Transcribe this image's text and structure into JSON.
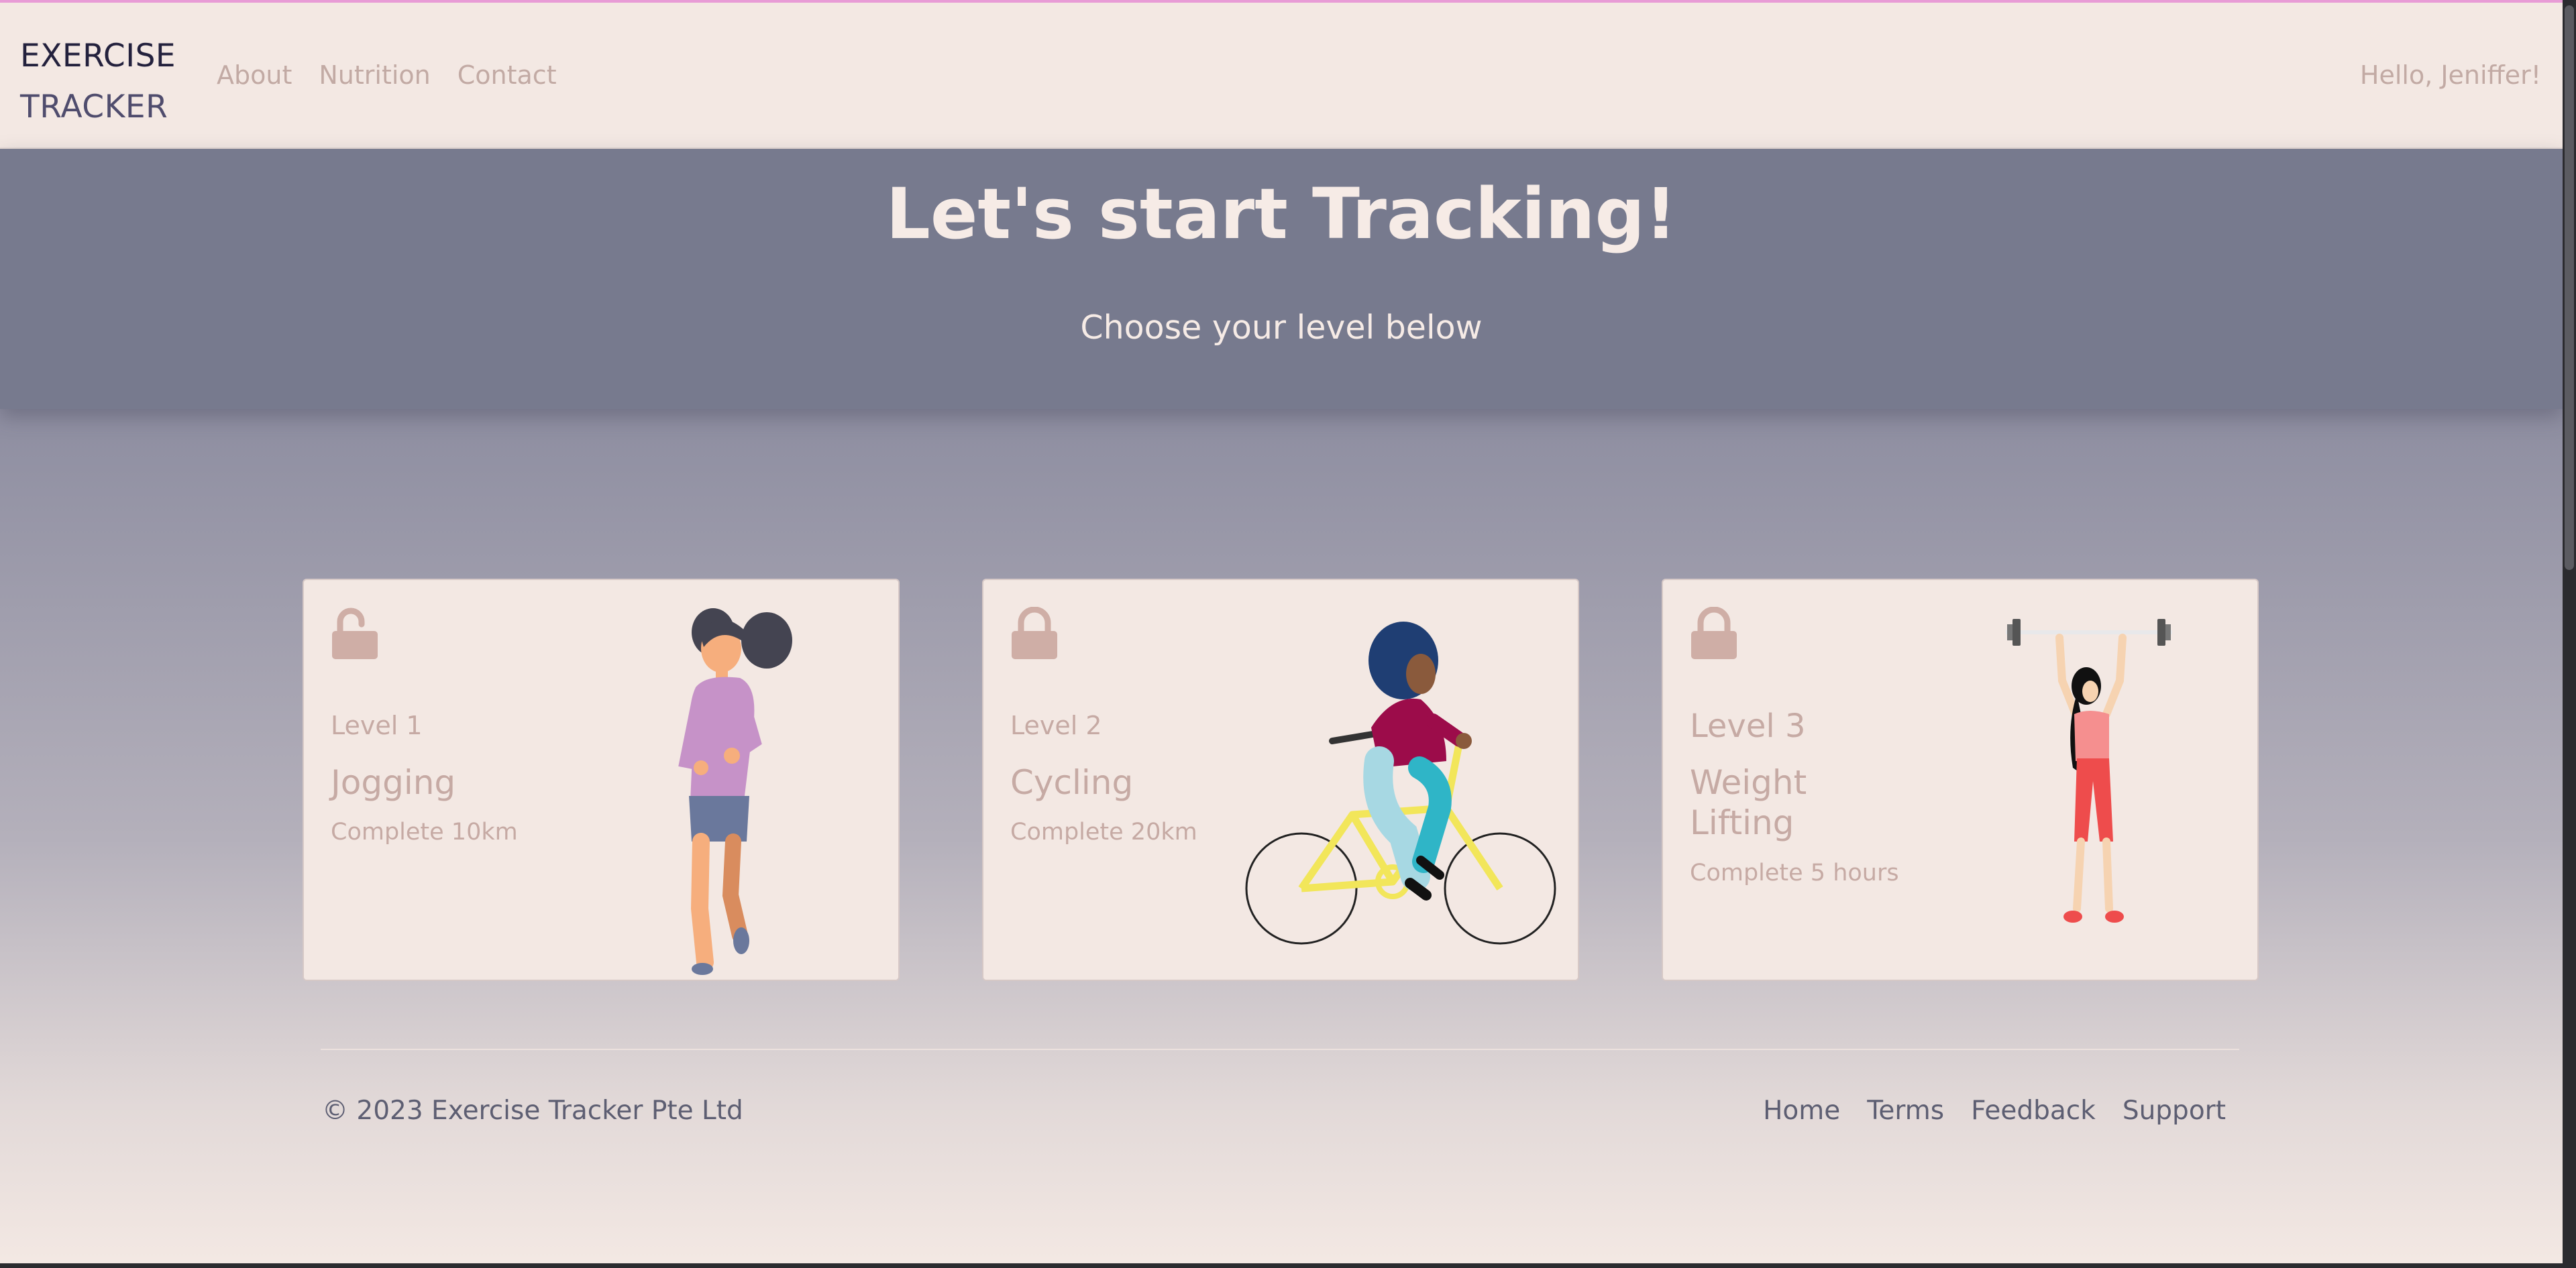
{
  "navbar": {
    "brand_line1": "EXERCISE",
    "brand_line2": "TRACKER",
    "links": [
      {
        "label": "About"
      },
      {
        "label": "Nutrition"
      },
      {
        "label": "Contact"
      }
    ],
    "greeting": "Hello, Jeniffer!"
  },
  "hero": {
    "title": "Let's start Tracking!",
    "subtitle": "Choose your level below"
  },
  "levels": [
    {
      "level": "Level 1",
      "name": "Jogging",
      "goal": "Complete 10km",
      "lock_icon": "unlocked-padlock-icon",
      "illustration": "jogging-woman"
    },
    {
      "level": "Level 2",
      "name": "Cycling",
      "goal": "Complete 20km",
      "lock_icon": "locked-padlock-icon",
      "illustration": "cycling-woman"
    },
    {
      "level": "Level 3",
      "name": "Weight Lifting",
      "goal": "Complete 5 hours",
      "lock_icon": "locked-padlock-icon",
      "illustration": "weightlifting-woman"
    }
  ],
  "footer": {
    "copyright": "© 2023 Exercise Tracker Pte Ltd",
    "links": [
      {
        "label": "Home"
      },
      {
        "label": "Terms"
      },
      {
        "label": "Feedback"
      },
      {
        "label": "Support"
      }
    ]
  },
  "colors": {
    "navbar_bg": "#f3e8e3",
    "hero_bg": "#777a8e",
    "card_bg": "#f3e8e3",
    "muted_text": "#c6aaa4",
    "brand_dark": "#23213d",
    "footer_text": "#5d5e72",
    "top_accent": "#e89bd6"
  }
}
